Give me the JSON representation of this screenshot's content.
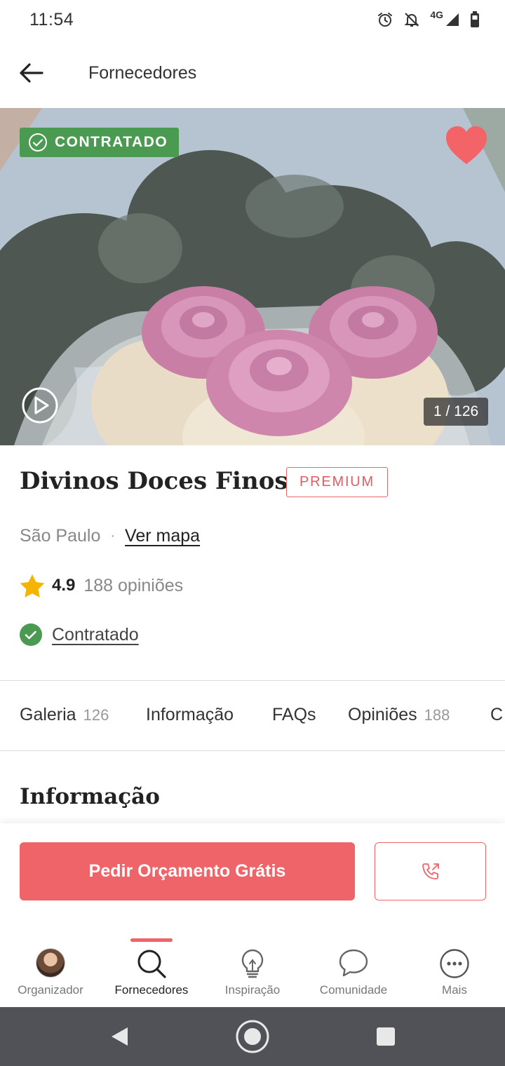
{
  "status_bar": {
    "time": "11:54",
    "network": "4G"
  },
  "app_bar": {
    "title": "Fornecedores"
  },
  "hero": {
    "badge": "CONTRATADO",
    "counter": "1 / 126"
  },
  "vendor": {
    "name": "Divinos Doces Finos",
    "tier_badge": "PREMIUM",
    "city": "São Paulo",
    "separator": "·",
    "map_link": "Ver mapa",
    "rating": "4.9",
    "reviews": "188 opiniões",
    "hired_label": "Contratado"
  },
  "tabs": [
    {
      "label": "Galeria",
      "count": "126"
    },
    {
      "label": "Informação",
      "count": ""
    },
    {
      "label": "FAQs",
      "count": ""
    },
    {
      "label": "Opiniões",
      "count": "188"
    },
    {
      "label": "C",
      "count": ""
    }
  ],
  "section": {
    "title": "Informação"
  },
  "actions": {
    "quote_label": "Pedir Orçamento Grátis"
  },
  "bottom_nav": [
    {
      "label": "Organizador",
      "icon": "avatar"
    },
    {
      "label": "Fornecedores",
      "icon": "search-icon"
    },
    {
      "label": "Inspiração",
      "icon": "lightbulb-icon"
    },
    {
      "label": "Comunidade",
      "icon": "chat-bubble-icon"
    },
    {
      "label": "Mais",
      "icon": "more-icon"
    }
  ],
  "colors": {
    "accent": "#ef6468",
    "success": "#4a9a51",
    "star": "#f5b400"
  }
}
